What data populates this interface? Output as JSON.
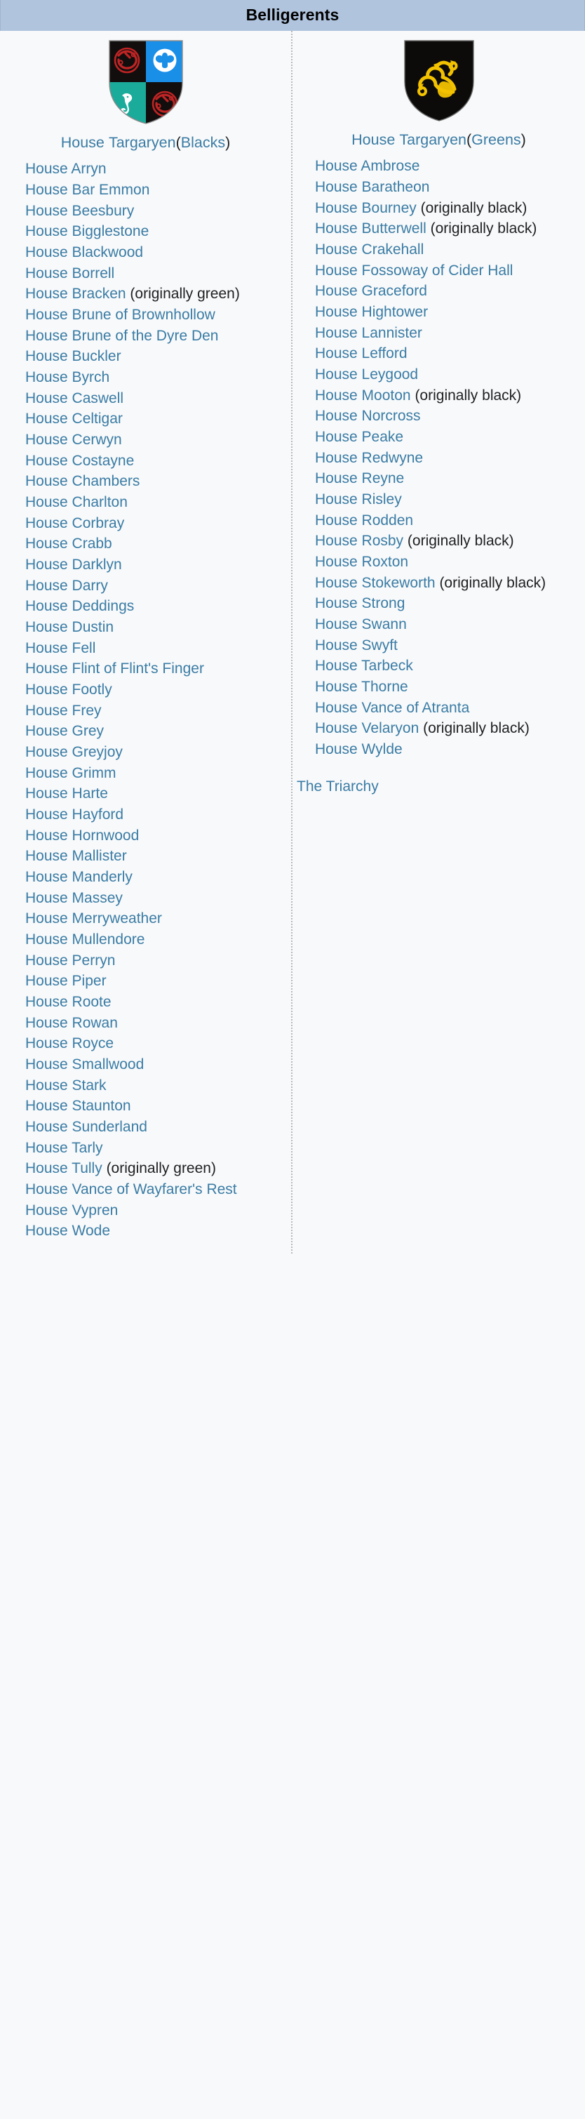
{
  "header": {
    "title": "Belligerents"
  },
  "colors": {
    "header_background": "#b0c4de",
    "link": "#3a7ca5",
    "page_background": "#f8f9fa",
    "divider": "#b9b9b9"
  },
  "blacks": {
    "coat_of_arms_name": "house-targaryen-blacks-coat-of-arms",
    "title_link": "House Targaryen",
    "title_paren_open": "(",
    "title_faction_link": "Blacks",
    "title_paren_close": ")",
    "allies": [
      {
        "link": "House Arryn"
      },
      {
        "link": "House Bar Emmon"
      },
      {
        "link": "House Beesbury"
      },
      {
        "link": "House Bigglestone"
      },
      {
        "link": "House Blackwood"
      },
      {
        "link": "House Borrell"
      },
      {
        "link": "House Bracken",
        "note": "(originally green)"
      },
      {
        "link": "House Brune of Brownhollow"
      },
      {
        "link": "House Brune of the Dyre Den"
      },
      {
        "link": "House Buckler"
      },
      {
        "link": "House Byrch"
      },
      {
        "link": "House Caswell"
      },
      {
        "link": "House Celtigar"
      },
      {
        "link": "House Cerwyn"
      },
      {
        "link": "House Costayne"
      },
      {
        "link": "House Chambers"
      },
      {
        "link": "House Charlton"
      },
      {
        "link": "House Corbray"
      },
      {
        "link": "House Crabb"
      },
      {
        "link": "House Darklyn"
      },
      {
        "link": "House Darry"
      },
      {
        "link": "House Deddings"
      },
      {
        "link": "House Dustin"
      },
      {
        "link": "House Fell"
      },
      {
        "link": "House Flint of Flint's Finger"
      },
      {
        "link": "House Footly"
      },
      {
        "link": "House Frey"
      },
      {
        "link": "House Grey"
      },
      {
        "link": "House Greyjoy"
      },
      {
        "link": "House Grimm"
      },
      {
        "link": "House Harte"
      },
      {
        "link": "House Hayford"
      },
      {
        "link": "House Hornwood"
      },
      {
        "link": "House Mallister"
      },
      {
        "link": "House Manderly"
      },
      {
        "link": "House Massey"
      },
      {
        "link": "House Merryweather"
      },
      {
        "link": "House Mullendore"
      },
      {
        "link": "House Perryn"
      },
      {
        "link": "House Piper"
      },
      {
        "link": "House Roote"
      },
      {
        "link": "House Rowan"
      },
      {
        "link": "House Royce"
      },
      {
        "link": "House Smallwood"
      },
      {
        "link": "House Stark"
      },
      {
        "link": "House Staunton"
      },
      {
        "link": "House Sunderland"
      },
      {
        "link": "House Tarly"
      },
      {
        "link": "House Tully",
        "note": "(originally green)"
      },
      {
        "link": "House Vance of Wayfarer's Rest"
      },
      {
        "link": "House Vypren"
      },
      {
        "link": "House Wode"
      }
    ]
  },
  "greens": {
    "coat_of_arms_name": "house-targaryen-greens-coat-of-arms",
    "title_link": "House Targaryen",
    "title_paren_open": "(",
    "title_faction_link": "Greens",
    "title_paren_close": ")",
    "allies": [
      {
        "link": "House Ambrose"
      },
      {
        "link": "House Baratheon"
      },
      {
        "link": "House Bourney",
        "note": "(originally black)"
      },
      {
        "link": "House Butterwell",
        "note": "(originally black)"
      },
      {
        "link": "House Crakehall"
      },
      {
        "link": "House Fossoway of Cider Hall"
      },
      {
        "link": "House Graceford"
      },
      {
        "link": "House Hightower"
      },
      {
        "link": "House Lannister"
      },
      {
        "link": "House Lefford"
      },
      {
        "link": "House Leygood"
      },
      {
        "link": "House Mooton",
        "note": "(originally black)"
      },
      {
        "link": "House Norcross"
      },
      {
        "link": "House Peake"
      },
      {
        "link": "House Redwyne"
      },
      {
        "link": "House Reyne"
      },
      {
        "link": "House Risley"
      },
      {
        "link": "House Rodden"
      },
      {
        "link": "House Rosby",
        "note": "(originally black)"
      },
      {
        "link": "House Roxton"
      },
      {
        "link": "House Stokeworth",
        "note": "(originally black)"
      },
      {
        "link": "House Strong"
      },
      {
        "link": "House Swann"
      },
      {
        "link": "House Swyft"
      },
      {
        "link": "House Tarbeck"
      },
      {
        "link": "House Thorne"
      },
      {
        "link": "House Vance of Atranta"
      },
      {
        "link": "House Velaryon",
        "note": "(originally black)"
      },
      {
        "link": "House Wylde"
      }
    ],
    "extra": [
      {
        "link": "The Triarchy"
      }
    ]
  }
}
